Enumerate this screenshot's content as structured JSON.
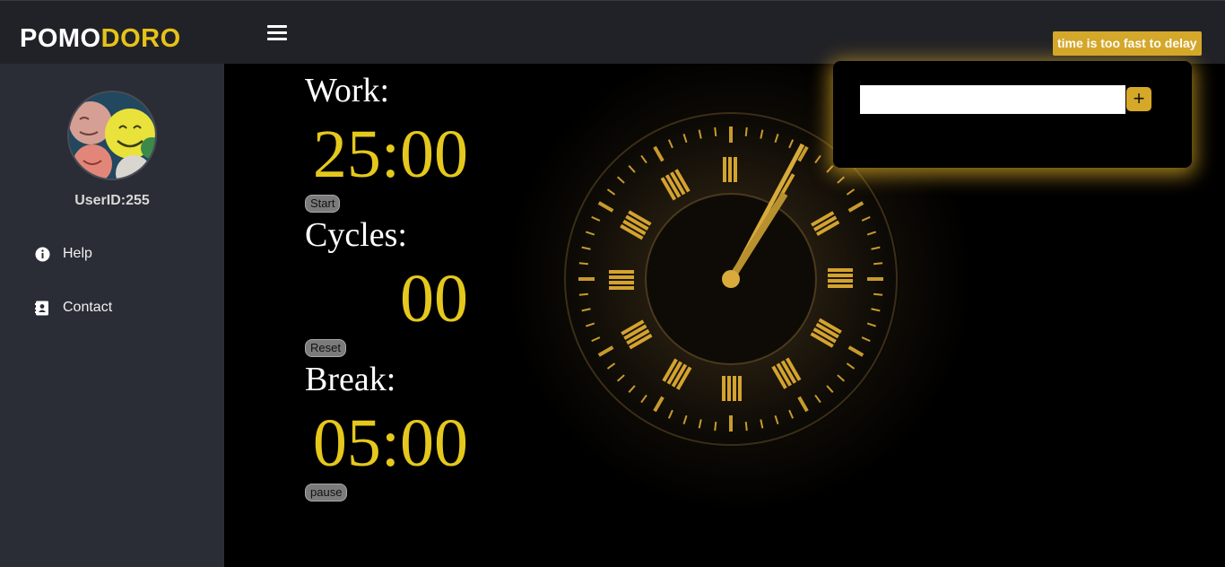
{
  "header": {
    "logo_part1": "POMO",
    "logo_part2": "DORO",
    "tagline": "time is too fast to delay",
    "menu_icon": "hamburger-icon"
  },
  "sidebar": {
    "user_id": "UserID:255",
    "items": [
      {
        "label": "Help",
        "icon": "info-icon"
      },
      {
        "label": "Contact",
        "icon": "contact-book-icon"
      }
    ]
  },
  "timer": {
    "work_label": "Work:",
    "work_time": "25:00",
    "start_label": "Start",
    "cycles_label": "Cycles:",
    "cycles_value": "00",
    "reset_label": "Reset",
    "break_label": "Break:",
    "break_time": "05:00",
    "pause_label": "pause"
  },
  "tasks": {
    "input_value": "",
    "add_label": "+"
  },
  "colors": {
    "accent": "#e5c81c",
    "topbar": "#212227",
    "sidebar": "#2b2d36",
    "tagline_bg": "#d4a82a"
  }
}
